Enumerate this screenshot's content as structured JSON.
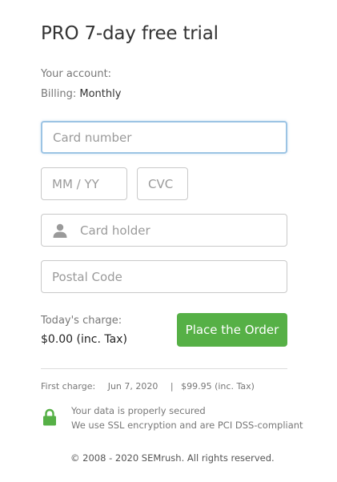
{
  "header": {
    "title": "PRO 7-day free trial"
  },
  "account": {
    "label": "Your account:",
    "billing_label": "Billing:",
    "billing_value": "Monthly"
  },
  "form": {
    "card_number": {
      "placeholder": "Card number",
      "value": ""
    },
    "expiry": {
      "placeholder": "MM / YY",
      "value": ""
    },
    "cvc": {
      "placeholder": "CVC",
      "value": ""
    },
    "card_holder": {
      "placeholder": "Card holder",
      "value": ""
    },
    "postal_code": {
      "placeholder": "Postal Code",
      "value": ""
    }
  },
  "charge": {
    "label": "Today's charge:",
    "value": "$0.00 (inc. Tax)"
  },
  "actions": {
    "order_label": "Place the Order"
  },
  "first_charge": {
    "label": "First charge:",
    "date": "Jun 7, 2020",
    "separator": "|",
    "amount": "$99.95 (inc. Tax)"
  },
  "security": {
    "line1": "Your data is properly secured",
    "line2": "We use SSL encryption and are PCI DSS-compliant",
    "icon": "lock-icon"
  },
  "footer": {
    "copyright": "© 2008 - 2020 SEMrush. All rights reserved."
  },
  "colors": {
    "accent_green": "#56b046",
    "focus_border": "#9cc4e4",
    "text_primary": "#333333",
    "text_muted": "#777777"
  }
}
